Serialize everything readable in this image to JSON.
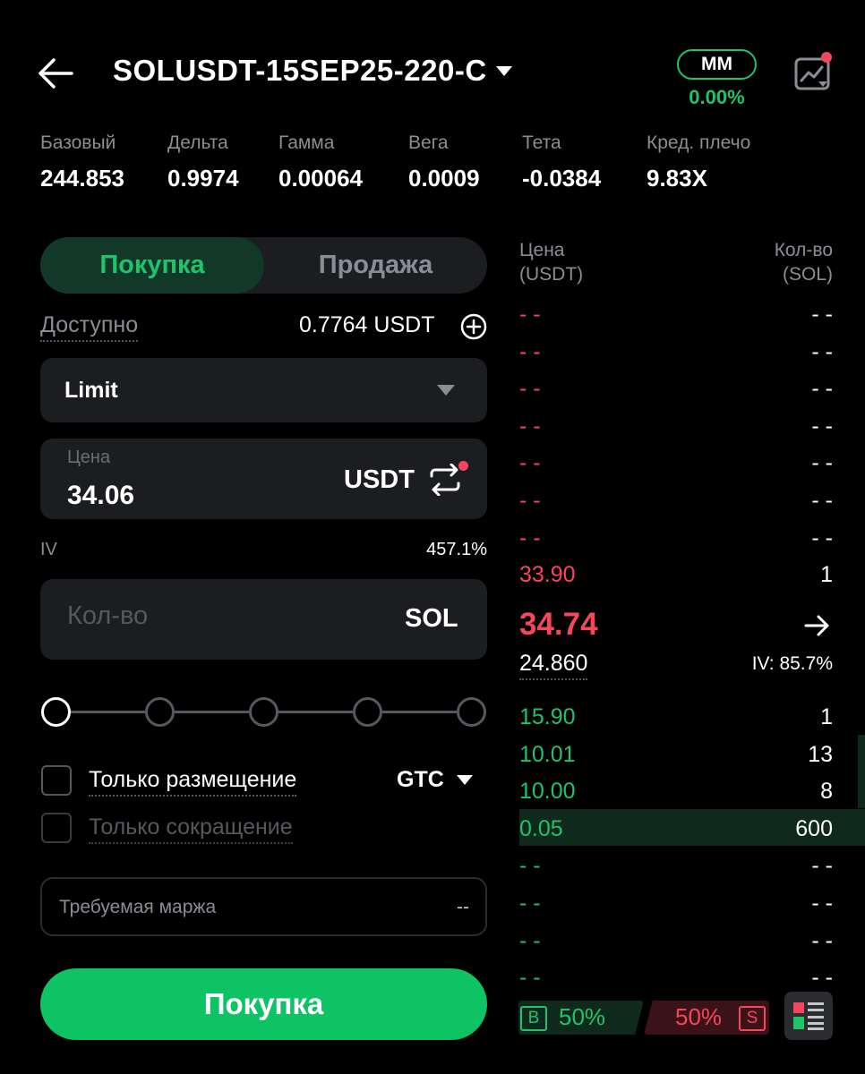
{
  "header": {
    "symbol": "SOLUSDT-15SEP25-220-C",
    "mm_label": "MM",
    "mm_value": "0.00%"
  },
  "stats": [
    {
      "label": "Базовый",
      "value": "244.853"
    },
    {
      "label": "Дельта",
      "value": "0.9974"
    },
    {
      "label": "Гамма",
      "value": "0.00064"
    },
    {
      "label": "Вега",
      "value": "0.0009"
    },
    {
      "label": "Тета",
      "value": "-0.0384"
    },
    {
      "label": "Кред. плечо",
      "value": "9.83X"
    }
  ],
  "form": {
    "tab_buy": "Покупка",
    "tab_sell": "Продажа",
    "available_label": "Доступно",
    "available_value": "0.7764 USDT",
    "order_type": "Limit",
    "price_label": "Цена",
    "price_value": "34.06",
    "price_unit": "USDT",
    "iv_label": "IV",
    "iv_value": "457.1%",
    "qty_placeholder": "Кол-во",
    "qty_unit": "SOL",
    "slider_level": 0,
    "post_only_label": "Только размещение",
    "reduce_only_label": "Только сокращение",
    "time_in_force": "GTC",
    "margin_label": "Требуемая маржа",
    "margin_value": "--",
    "submit_label": "Покупка"
  },
  "orderbook": {
    "price_header_1": "Цена",
    "price_header_2": "(USDT)",
    "qty_header_1": "Кол-во",
    "qty_header_2": "(SOL)",
    "asks": [
      {
        "price": "- -",
        "qty": "- -"
      },
      {
        "price": "- -",
        "qty": "- -"
      },
      {
        "price": "- -",
        "qty": "- -"
      },
      {
        "price": "- -",
        "qty": "- -"
      },
      {
        "price": "- -",
        "qty": "- -"
      },
      {
        "price": "- -",
        "qty": "- -"
      },
      {
        "price": "- -",
        "qty": "- -"
      },
      {
        "price": "33.90",
        "qty": "1"
      }
    ],
    "mark_price": "34.74",
    "index_price": "24.860",
    "mark_iv": "IV: 85.7%",
    "bids": [
      {
        "price": "15.90",
        "qty": "1",
        "depth": 0.0
      },
      {
        "price": "10.01",
        "qty": "13",
        "depth": 0.02
      },
      {
        "price": "10.00",
        "qty": "8",
        "depth": 0.02
      },
      {
        "price": "0.05",
        "qty": "600",
        "depth": 1.0
      },
      {
        "price": "- -",
        "qty": "- -",
        "depth": 0
      },
      {
        "price": "- -",
        "qty": "- -",
        "depth": 0
      },
      {
        "price": "- -",
        "qty": "- -",
        "depth": 0
      },
      {
        "price": "- -",
        "qty": "- -",
        "depth": 0
      }
    ],
    "ratio_buy_label": "B",
    "ratio_buy_pct": "50%",
    "ratio_sell_pct": "50%",
    "ratio_sell_label": "S"
  },
  "colors": {
    "green": "#1fc36a",
    "red": "#f6465d",
    "button_green": "#0ec363"
  }
}
